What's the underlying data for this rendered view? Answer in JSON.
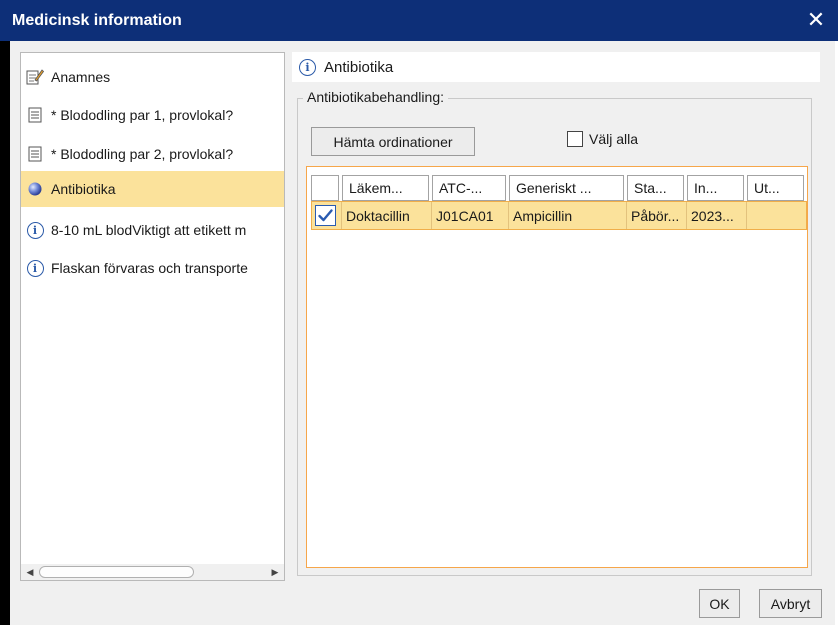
{
  "window": {
    "title": "Medicinsk information",
    "close_glyph": "✕"
  },
  "nav": {
    "items": [
      {
        "label": "Anamnes",
        "icon": "edit-note-icon"
      },
      {
        "label": "* Blododling par 1, provlokal?",
        "icon": "document-list-icon"
      },
      {
        "label": "* Blododling par 2, provlokal?",
        "icon": "document-list-icon"
      },
      {
        "label": "Antibiotika",
        "icon": "blue-sphere-icon",
        "selected": true
      },
      {
        "label": "8-10 mL blodViktigt att etikett m",
        "icon": "info-icon"
      },
      {
        "label": "Flaskan förvaras och transporte",
        "icon": "info-icon"
      }
    ]
  },
  "section": {
    "title": "Antibiotika",
    "group_label": "Antibiotikabehandling:",
    "fetch_button": "Hämta ordinationer",
    "select_all_label": "Välj alla",
    "select_all_checked": false
  },
  "table": {
    "headers": [
      "Läkem...",
      "ATC-...",
      "Generiskt ...",
      "Sta...",
      "In...",
      "Ut..."
    ],
    "rows": [
      {
        "checked": true,
        "cells": [
          "Doktacillin",
          "J01CA01",
          "Ampicillin",
          "Påbör...",
          "2023...",
          ""
        ]
      }
    ]
  },
  "footer": {
    "ok_label": "OK",
    "cancel_label": "Avbryt"
  },
  "colors": {
    "titlebar": "#0d2f78",
    "selection": "#fbe29b",
    "accent_border": "#f6a64a",
    "info_blue": "#2b5aa8"
  }
}
